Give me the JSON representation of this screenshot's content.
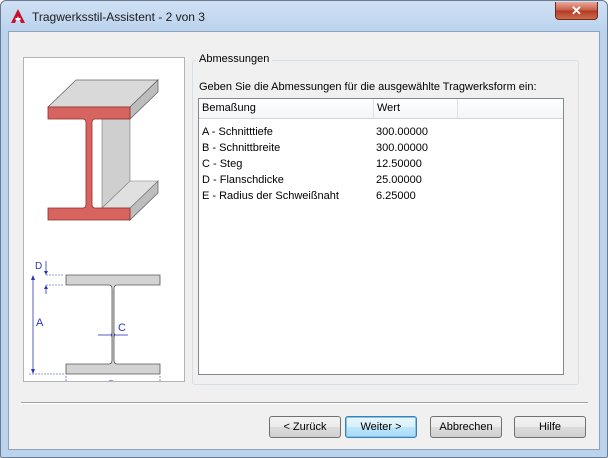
{
  "window": {
    "title": "Tragwerksstil-Assistent - 2 von 3",
    "close_glyph": "✕"
  },
  "app_icon": {
    "name": "autocad-logo-icon",
    "letter": "A",
    "color": "#c8102e"
  },
  "group": {
    "title": "Abmessungen",
    "instruction": "Geben Sie die Abmessungen für die ausgewählte Tragwerksform ein:"
  },
  "table": {
    "columns": [
      "Bemaßung",
      "Wert"
    ],
    "rows": [
      {
        "name": "A - Schnitttiefe",
        "value": "300.00000"
      },
      {
        "name": "B - Schnittbreite",
        "value": "300.00000"
      },
      {
        "name": "C - Steg",
        "value": "12.50000"
      },
      {
        "name": "D - Flanschdicke",
        "value": "25.00000"
      },
      {
        "name": "E - Radius der Schweißnaht",
        "value": "6.25000"
      }
    ]
  },
  "diagram": {
    "label_d": "D",
    "label_a": "A",
    "label_c": "C",
    "label_b": "B",
    "dim_color": "#2b35b8",
    "section_color": "#d8645f"
  },
  "buttons": {
    "back": "< Zurück",
    "next": "Weiter >",
    "cancel": "Abbrechen",
    "help": "Hilfe"
  }
}
